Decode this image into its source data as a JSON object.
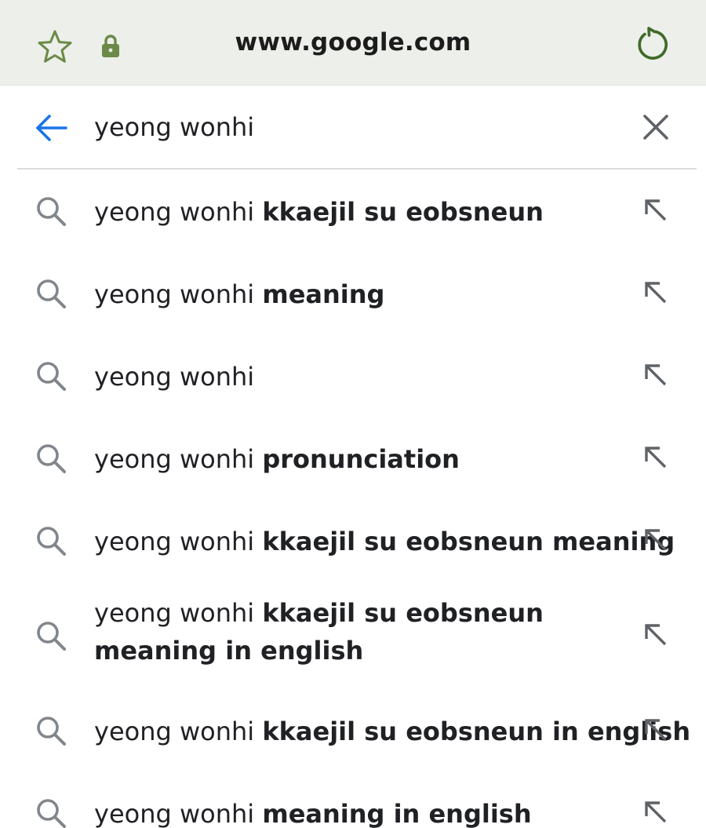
{
  "browser": {
    "url": "www.google.com",
    "colors": {
      "bar_bg": "#edefea",
      "icon_green": "#6b8a48",
      "reload_green": "#3f6a28"
    }
  },
  "search": {
    "query": "yeong wonhi",
    "back_color": "#1a73e8"
  },
  "suggestions": [
    {
      "prefix": "yeong wonhi ",
      "bold": "kkaejil su eobsneun"
    },
    {
      "prefix": "yeong wonhi ",
      "bold": "meaning"
    },
    {
      "prefix": "yeong wonhi",
      "bold": ""
    },
    {
      "prefix": "yeong wonhi ",
      "bold": "pronunciation"
    },
    {
      "prefix": "yeong wonhi ",
      "bold": "kkaejil su eobsneun meaning"
    },
    {
      "prefix": "yeong wonhi ",
      "bold": "kkaejil su eobsneun meaning in english"
    },
    {
      "prefix": "yeong wonhi ",
      "bold": "kkaejil su eobsneun in english"
    },
    {
      "prefix": "yeong wonhi ",
      "bold": "meaning in english"
    }
  ],
  "icons": {
    "bookmark": "star-icon",
    "secure": "lock-icon",
    "reload": "reload-icon",
    "back": "back-arrow-icon",
    "clear": "close-icon",
    "suggestion": "search-icon",
    "fill": "arrow-up-left-icon"
  }
}
